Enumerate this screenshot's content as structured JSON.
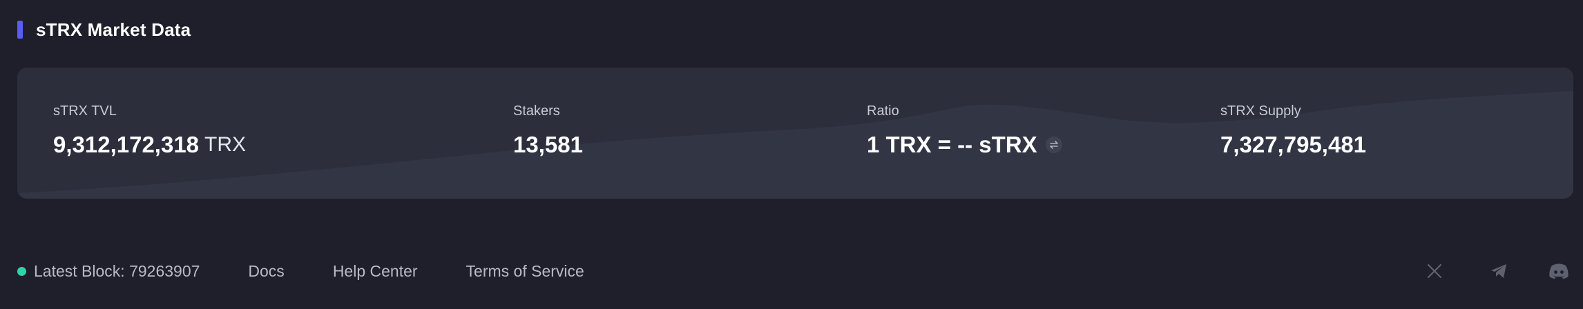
{
  "section": {
    "title": "sTRX Market Data"
  },
  "stats": [
    {
      "label": "sTRX TVL",
      "value": "9,312,172,318",
      "unit": "TRX"
    },
    {
      "label": "Stakers",
      "value": "13,581"
    },
    {
      "label": "Ratio",
      "value": "1 TRX = -- sTRX",
      "icon": "swap-icon"
    },
    {
      "label": "sTRX Supply",
      "value": "7,327,795,481"
    }
  ],
  "footer": {
    "latest_block": "Latest Block: 79263907",
    "links": [
      "Docs",
      "Help Center",
      "Terms of Service"
    ],
    "social_icons": [
      "x-icon",
      "telegram-icon",
      "discord-icon"
    ]
  },
  "colors": {
    "background": "#1e1f2a",
    "card": "#2c2f3b",
    "accent": "#5b5cf5",
    "status": "#2fd3a8"
  }
}
